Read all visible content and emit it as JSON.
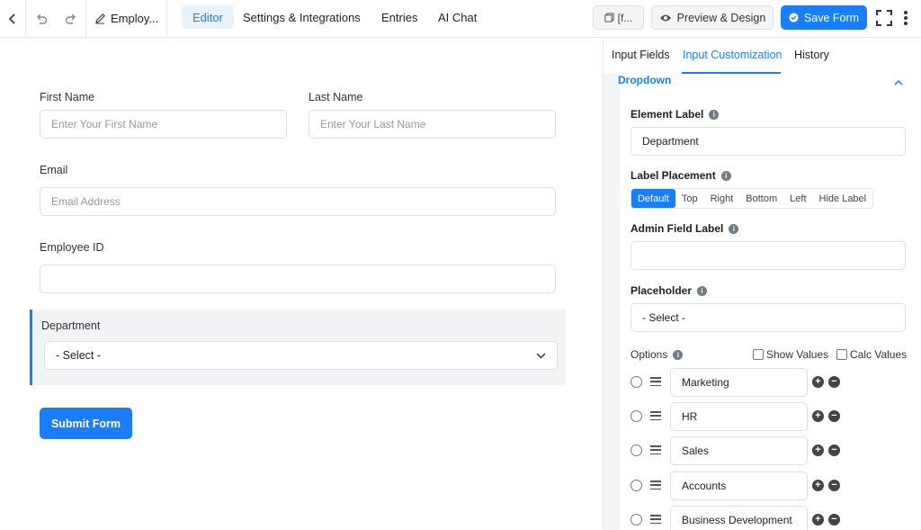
{
  "topbar": {
    "form_name": "Employ...",
    "tabs": [
      {
        "label": "Editor"
      },
      {
        "label": "Settings & Integrations"
      },
      {
        "label": "Entries"
      },
      {
        "label": "AI Chat"
      }
    ],
    "shortcode_label": "[f...",
    "preview_label": "Preview & Design",
    "save_label": "Save Form"
  },
  "form": {
    "first_name": {
      "label": "First Name",
      "placeholder": "Enter Your First Name"
    },
    "last_name": {
      "label": "Last Name",
      "placeholder": "Enter Your Last Name"
    },
    "email": {
      "label": "Email",
      "placeholder": "Email Address"
    },
    "employee_id": {
      "label": "Employee ID",
      "placeholder": ""
    },
    "department": {
      "label": "Department",
      "value": "- Select -"
    },
    "submit_label": "Submit Form"
  },
  "panel": {
    "tabs": [
      {
        "label": "Input Fields"
      },
      {
        "label": "Input Customization"
      },
      {
        "label": "History"
      }
    ],
    "section_title": "Dropdown",
    "element_label": {
      "label": "Element Label",
      "value": "Department"
    },
    "label_placement": {
      "label": "Label Placement",
      "options": [
        "Default",
        "Top",
        "Right",
        "Bottom",
        "Left",
        "Hide Label"
      ],
      "selected": "Default"
    },
    "admin_field_label": {
      "label": "Admin Field Label",
      "value": ""
    },
    "placeholder": {
      "label": "Placeholder",
      "value": "- Select -"
    },
    "options": {
      "label": "Options",
      "show_values_label": "Show Values",
      "calc_values_label": "Calc Values",
      "items": [
        "Marketing",
        "HR",
        "Sales",
        "Accounts",
        "Business Development"
      ]
    }
  },
  "colors": {
    "accent": "#1a7efb",
    "panel_bg": "#f4f5f7",
    "field_bg": "#f2f3f5"
  }
}
